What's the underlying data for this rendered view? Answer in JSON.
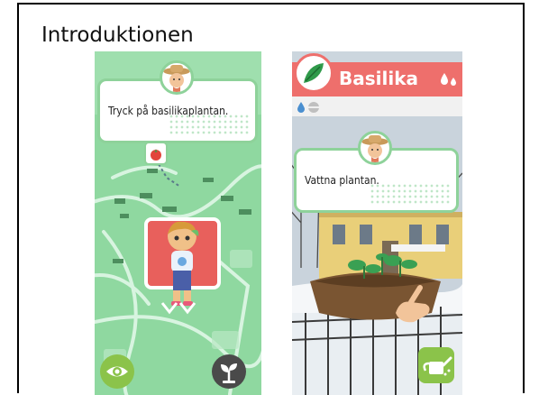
{
  "heading": "Introduktionen",
  "left_screen": {
    "hint_text": "Tryck på basilikaplantan.",
    "eye_button_icon": "eye-icon",
    "plant_button_icon": "sprout-icon",
    "colors": {
      "map": "#8fd8a0",
      "bubble_border": "#8ed29a",
      "card": "#e8605c",
      "eye_btn": "#8bc34a",
      "plant_btn": "#4a4a4a"
    }
  },
  "right_screen": {
    "plant_name": "Basilika",
    "hint_text": "Vattna plantan.",
    "water_button_icon": "watering-can-icon",
    "colors": {
      "header": "#ee6f6c",
      "header_text": "#ffffff",
      "water_btn": "#8bc34a"
    }
  }
}
